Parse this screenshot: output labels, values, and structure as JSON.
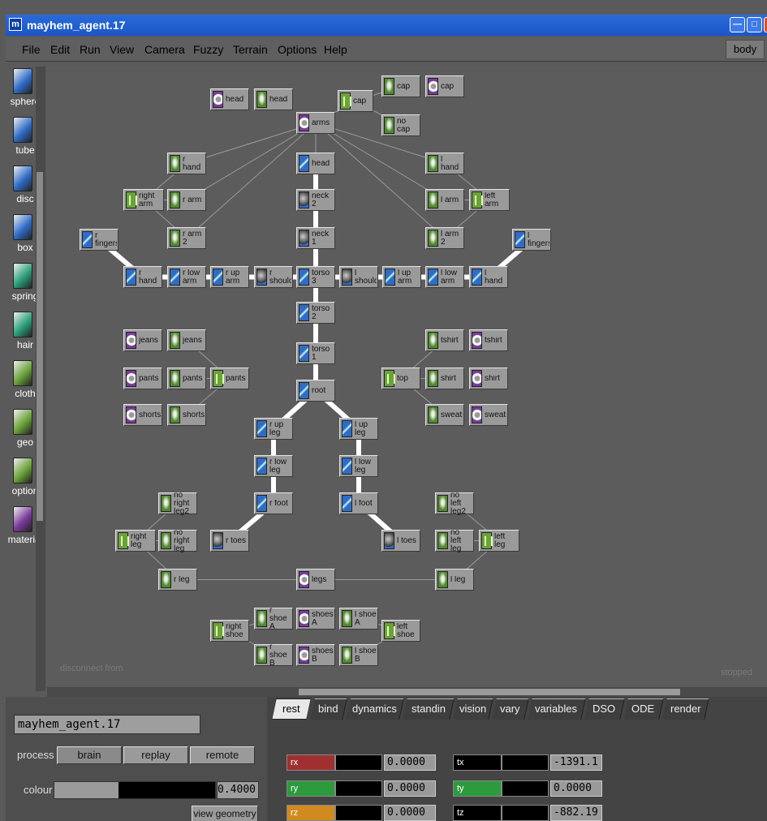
{
  "window": {
    "title": "mayhem_agent.17",
    "app_icon": "m",
    "controls": [
      "minimize-icon",
      "maximize-icon",
      "close-icon"
    ]
  },
  "menu": {
    "items": [
      "File",
      "Edit",
      "Run",
      "View",
      "Camera",
      "Fuzzy",
      "Terrain",
      "Options",
      "Help"
    ],
    "mode_label": "body"
  },
  "toolbar": {
    "tools": [
      {
        "label": "sphere",
        "icon": "sphere-icon",
        "color": "#2e6cc8"
      },
      {
        "label": "tube",
        "icon": "tube-icon",
        "color": "#2e6cc8"
      },
      {
        "label": "disc",
        "icon": "disc-icon",
        "color": "#2e6cc8"
      },
      {
        "label": "box",
        "icon": "box-icon",
        "color": "#2e6cc8"
      },
      {
        "label": "spring",
        "icon": "spring-icon",
        "color": "#2aa07a"
      },
      {
        "label": "hair",
        "icon": "hair-icon",
        "color": "#2aa07a"
      },
      {
        "label": "cloth",
        "icon": "cloth-icon",
        "color": "#6aa33a"
      },
      {
        "label": "geo",
        "icon": "geo-icon",
        "color": "#6aa33a"
      },
      {
        "label": "option",
        "icon": "option-icon",
        "color": "#6aa33a"
      },
      {
        "label": "material",
        "icon": "material-icon",
        "color": "#7a3a9a"
      }
    ]
  },
  "graph": {
    "hint_left": "disconnect from",
    "status": "stopped",
    "nodes": [
      {
        "id": "head_mat",
        "label": "head",
        "type": "material"
      },
      {
        "id": "head_geo",
        "label": "head",
        "type": "geo"
      },
      {
        "id": "cap_opt",
        "label": "cap",
        "type": "option"
      },
      {
        "id": "cap_geo",
        "label": "cap",
        "type": "geo"
      },
      {
        "id": "cap_mat",
        "label": "cap",
        "type": "material"
      },
      {
        "id": "nocap_geo",
        "label": "no cap",
        "type": "geo"
      },
      {
        "id": "arms_mat",
        "label": "arms",
        "type": "material"
      },
      {
        "id": "rhand_geo",
        "label": "r hand",
        "type": "geo"
      },
      {
        "id": "head_tube",
        "label": "head",
        "type": "tube"
      },
      {
        "id": "lhand_geo",
        "label": "l hand",
        "type": "geo"
      },
      {
        "id": "rightarm_opt",
        "label": "right arm",
        "type": "option"
      },
      {
        "id": "rarm_geo",
        "label": "r arm",
        "type": "geo"
      },
      {
        "id": "neck2",
        "label": "neck 2",
        "type": "sphere"
      },
      {
        "id": "larm_geo",
        "label": "l arm",
        "type": "geo"
      },
      {
        "id": "leftarm_opt",
        "label": "left arm",
        "type": "option"
      },
      {
        "id": "rfingers",
        "label": "r fingers",
        "type": "tube"
      },
      {
        "id": "rarm2_geo",
        "label": "r arm 2",
        "type": "geo"
      },
      {
        "id": "neck1",
        "label": "neck 1",
        "type": "sphere"
      },
      {
        "id": "larm2_geo",
        "label": "l arm 2",
        "type": "geo"
      },
      {
        "id": "lfingers",
        "label": "l fingers",
        "type": "tube"
      },
      {
        "id": "rhand_tube",
        "label": "r hand",
        "type": "tube"
      },
      {
        "id": "rlowarm",
        "label": "r low arm",
        "type": "tube"
      },
      {
        "id": "ruparm",
        "label": "r up arm",
        "type": "tube"
      },
      {
        "id": "rshoulder",
        "label": "r shoulder",
        "type": "sphere"
      },
      {
        "id": "torso3",
        "label": "torso 3",
        "type": "tube"
      },
      {
        "id": "lshoulder",
        "label": "l shoulder",
        "type": "sphere"
      },
      {
        "id": "luparm",
        "label": "l up arm",
        "type": "tube"
      },
      {
        "id": "llowarm",
        "label": "l low arm",
        "type": "tube"
      },
      {
        "id": "lhand_tube",
        "label": "l hand",
        "type": "tube"
      },
      {
        "id": "torso2",
        "label": "torso 2",
        "type": "tube"
      },
      {
        "id": "jeans_mat",
        "label": "jeans",
        "type": "material"
      },
      {
        "id": "jeans_geo",
        "label": "jeans",
        "type": "geo"
      },
      {
        "id": "tshirt_geo",
        "label": "tshirt",
        "type": "geo"
      },
      {
        "id": "tshirt_mat",
        "label": "tshirt",
        "type": "material"
      },
      {
        "id": "torso1",
        "label": "torso 1",
        "type": "tube"
      },
      {
        "id": "pants_mat",
        "label": "pants",
        "type": "material"
      },
      {
        "id": "pants_geo",
        "label": "pants",
        "type": "geo"
      },
      {
        "id": "pants_opt",
        "label": "pants",
        "type": "option"
      },
      {
        "id": "root",
        "label": "root",
        "type": "tube"
      },
      {
        "id": "top_opt",
        "label": "top",
        "type": "option"
      },
      {
        "id": "shirt_geo",
        "label": "shirt",
        "type": "geo"
      },
      {
        "id": "shirt_mat",
        "label": "shirt",
        "type": "material"
      },
      {
        "id": "shorts_mat",
        "label": "shorts",
        "type": "material"
      },
      {
        "id": "shorts_geo",
        "label": "shorts",
        "type": "geo"
      },
      {
        "id": "sweat_geo",
        "label": "sweatshirt",
        "type": "geo"
      },
      {
        "id": "sweat_mat",
        "label": "sweatshirt",
        "type": "material"
      },
      {
        "id": "rupleg",
        "label": "r up leg",
        "type": "tube"
      },
      {
        "id": "lupleg",
        "label": "l up leg",
        "type": "tube"
      },
      {
        "id": "rlowleg",
        "label": "r low leg",
        "type": "tube"
      },
      {
        "id": "llowleg",
        "label": "l low leg",
        "type": "tube"
      },
      {
        "id": "norightleg2",
        "label": "no right leg2",
        "type": "geo"
      },
      {
        "id": "rfoot",
        "label": "r foot",
        "type": "tube"
      },
      {
        "id": "lfoot",
        "label": "l foot",
        "type": "tube"
      },
      {
        "id": "noleftleg2",
        "label": "no left leg2",
        "type": "geo"
      },
      {
        "id": "rightleg_opt",
        "label": "right leg",
        "type": "option"
      },
      {
        "id": "norightleg",
        "label": "no right leg",
        "type": "geo"
      },
      {
        "id": "rtoes",
        "label": "r toes",
        "type": "sphere"
      },
      {
        "id": "ltoes",
        "label": "l toes",
        "type": "sphere"
      },
      {
        "id": "noleftleg",
        "label": "no left leg",
        "type": "geo"
      },
      {
        "id": "leftleg_opt",
        "label": "left leg",
        "type": "option"
      },
      {
        "id": "rleg_geo",
        "label": "r leg",
        "type": "geo"
      },
      {
        "id": "legs_mat",
        "label": "legs",
        "type": "material"
      },
      {
        "id": "lleg_geo",
        "label": "l leg",
        "type": "geo"
      },
      {
        "id": "rshoeA",
        "label": "r shoe A",
        "type": "geo"
      },
      {
        "id": "shoesA",
        "label": "shoes A",
        "type": "material"
      },
      {
        "id": "lshoeA",
        "label": "l shoe A",
        "type": "geo"
      },
      {
        "id": "rightshoe_opt",
        "label": "right shoe",
        "type": "option"
      },
      {
        "id": "leftshoe_opt",
        "label": "left shoe",
        "type": "option"
      },
      {
        "id": "rshoeB",
        "label": "r shoe B",
        "type": "geo"
      },
      {
        "id": "shoesB",
        "label": "shoes B",
        "type": "material"
      },
      {
        "id": "lshoeB",
        "label": "l shoe B",
        "type": "geo"
      }
    ]
  },
  "bottom": {
    "agent_name": "mayhem_agent.17",
    "process_label": "process",
    "process_buttons": [
      "brain",
      "replay",
      "remote"
    ],
    "colour_label": "colour",
    "colour_value": "0.4000",
    "colour_level": 0.4,
    "view_geometry": "view geometry",
    "tabs": [
      "rest",
      "bind",
      "dynamics",
      "standin",
      "vision",
      "vary",
      "variables",
      "DSO",
      "ODE",
      "render"
    ],
    "active_tab": "rest",
    "params": [
      {
        "label": "rx",
        "value": "0.0000",
        "color": "#a03030"
      },
      {
        "label": "tx",
        "value": "-1391.1",
        "color": "#000000"
      },
      {
        "label": "ry",
        "value": "0.0000",
        "color": "#2e9a3e"
      },
      {
        "label": "ty",
        "value": "0.0000",
        "color": "#2e9a3e"
      },
      {
        "label": "rz",
        "value": "0.0000",
        "color": "#d08a20"
      },
      {
        "label": "tz",
        "value": "-882.19",
        "color": "#000000"
      }
    ]
  }
}
